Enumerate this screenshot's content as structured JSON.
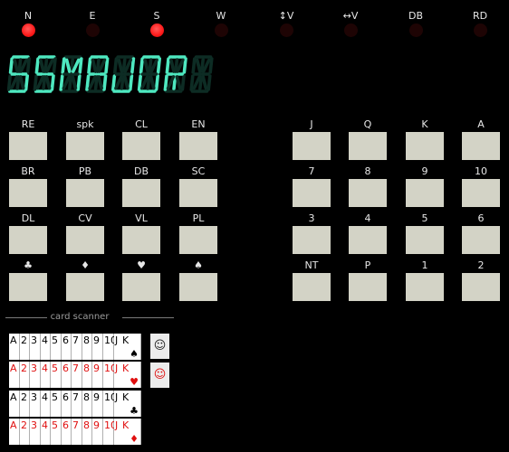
{
  "indicators": [
    {
      "label": "N",
      "on": true
    },
    {
      "label": "E",
      "on": false
    },
    {
      "label": "S",
      "on": true
    },
    {
      "label": "W",
      "on": false
    },
    {
      "label": "↕V",
      "on": false
    },
    {
      "label": "↔V",
      "on": false
    },
    {
      "label": "DB",
      "on": false
    },
    {
      "label": "RD",
      "on": false
    }
  ],
  "display": {
    "text": "SSMAJOR",
    "color_on": "#4ee8c0",
    "color_off": "#0d2c24"
  },
  "left_buttons": [
    [
      "RE",
      "spk",
      "CL",
      "EN"
    ],
    [
      "BR",
      "PB",
      "DB",
      "SC"
    ],
    [
      "DL",
      "CV",
      "VL",
      "PL"
    ],
    [
      "♣",
      "♦",
      "♥",
      "♠"
    ]
  ],
  "right_buttons": [
    [
      "J",
      "Q",
      "K",
      "A"
    ],
    [
      "7",
      "8",
      "9",
      "10"
    ],
    [
      "3",
      "4",
      "5",
      "6"
    ],
    [
      "NT",
      "P",
      "1",
      "2"
    ]
  ],
  "scanner": {
    "title": "card scanner",
    "ranks": [
      "A",
      "2",
      "3",
      "4",
      "5",
      "6",
      "7",
      "8",
      "9",
      "10",
      "J",
      "Q",
      "K"
    ],
    "rows": [
      {
        "suit": "♠",
        "color": "black"
      },
      {
        "suit": "♥",
        "color": "red"
      },
      {
        "suit": "♣",
        "color": "black"
      },
      {
        "suit": "♦",
        "color": "red"
      }
    ],
    "face_buttons": [
      {
        "glyph": "☺",
        "color": "#222222"
      },
      {
        "glyph": "☺",
        "color": "#e01010"
      }
    ]
  }
}
